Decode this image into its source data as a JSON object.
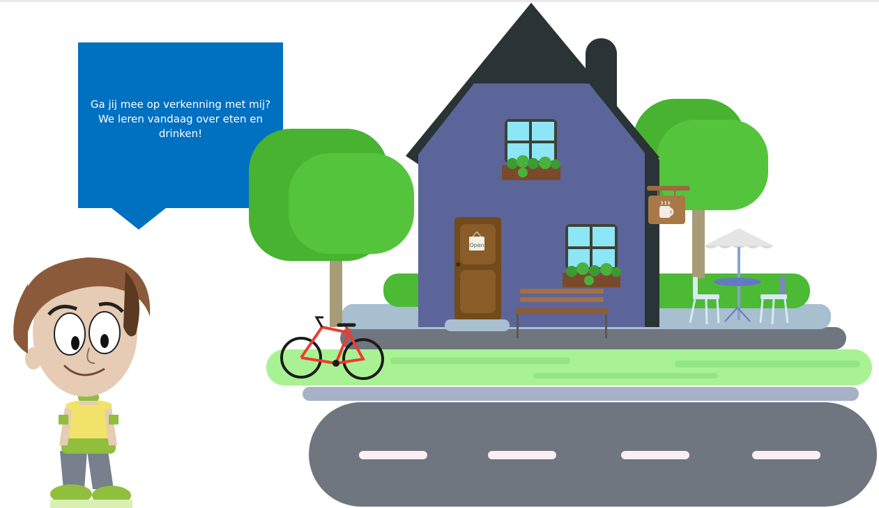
{
  "speech_bubble": {
    "line1": "Ga jij mee op verkenning met mij?",
    "line2": "We leren vandaag over eten en",
    "line3": "drinken!"
  },
  "door_sign": {
    "text": "Open"
  },
  "colors": {
    "bubble": "#0070c0",
    "house": "#5b6599",
    "roof": "#2a3335",
    "tree": "#55c43d",
    "grass": "#a8f294",
    "road": "#707680",
    "bike": "#ef3b2f"
  },
  "icons": {
    "shop_sign": "coffee-cup-icon"
  }
}
